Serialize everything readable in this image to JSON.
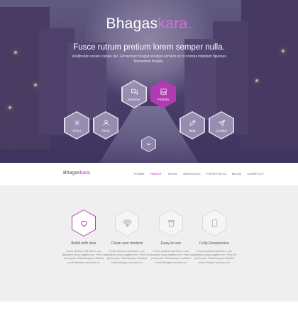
{
  "hero": {
    "brand_main": "Bhagas",
    "brand_accent": "kara.",
    "tagline": "Fusce rutrum pretium lorem semper nulla.",
    "subtext": "Vestibulum ornare cursus dui. Fermentum feugiat volutpat sentium ex id nostras interdum figurises fermentum fringilla."
  },
  "hex_nav": [
    {
      "label": "Services",
      "icon": "chat-bubbles-icon"
    },
    {
      "label": "Portfolio",
      "icon": "image-frame-icon"
    },
    {
      "label": "About",
      "icon": "gear-icon"
    },
    {
      "label": "Team",
      "icon": "user-icon"
    },
    {
      "label": "Blog",
      "icon": "pencil-icon"
    },
    {
      "label": "Contact",
      "icon": "paper-plane-icon"
    }
  ],
  "navbar": {
    "brand_main": "Bhagas",
    "brand_accent": "kara.",
    "items": [
      "HOME",
      "ABOUT",
      "TEAM",
      "SERVICES",
      "PORTFOLIO",
      "BLOG",
      "CONTACT"
    ],
    "active": "ABOUT"
  },
  "features": [
    {
      "title": "Build with love",
      "icon": "heart-icon",
      "desc": "Fusce facilisis velit libero, nec dignissim lacus sagittis non. Proin at porta justo. Pellentesque habitant morbi tristique senectus et."
    },
    {
      "title": "Clean and modern",
      "icon": "diamond-icon",
      "desc": "Fusce facilisis velit libero, nec dignissim lacus sagittis non. Proin at porta justo. Pellentesque habitant morbi tristique senectus et."
    },
    {
      "title": "Easy to use",
      "icon": "coffee-cup-icon",
      "desc": "Fusce facilisis velit libero, nec dignissim lacus sagittis non. Proin at porta justo. Pellentesque habitant morbi tristique senectus et."
    },
    {
      "title": "Fully Responsive",
      "icon": "tablet-icon",
      "desc": "Fusce facilisis velit libero, nec dignissim lacus sagittis non. Proin at porta justo. Pellentesque habitant morbi tristique senectus et."
    }
  ],
  "colors": {
    "accent": "#b13bb3",
    "hero_overlay": "#46376e",
    "features_bg": "#efefef"
  }
}
